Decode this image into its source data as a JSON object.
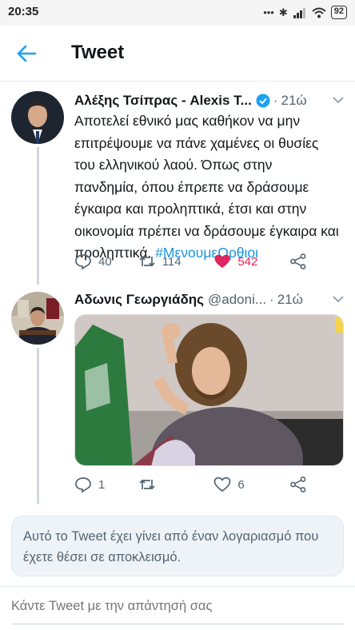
{
  "status": {
    "time": "20:35",
    "battery": "92"
  },
  "header": {
    "title": "Tweet"
  },
  "tweet1": {
    "name": "Αλέξης Τσίπρας - Alexis T...",
    "time": "21ώ",
    "text": "Αποτελεί εθνικό μας καθήκον να μην επιτρέψουμε να πάνε χαμένες οι θυσίες του ελληνικού λαού. Όπως στην πανδημία, όπου έπρεπε να δράσουμε έγκαιρα και προληπτικά, έτσι και στην οικονομία πρέπει να δράσουμε έγκαιρα και προληπτικά.",
    "hashtag": "#ΜενουμεΟρθιοι",
    "replies": "40",
    "retweets": "114",
    "likes": "542",
    "like_color": "#e0245e"
  },
  "tweet2": {
    "name": "Αδωνις Γεωργιάδης",
    "handle": "@adoni...",
    "time": "21ώ",
    "replies": "1",
    "retweets": "",
    "likes": "6"
  },
  "notice": {
    "text": "Αυτό το Tweet έχει γίνει από έναν λογαριασμό που έχετε θέσει σε αποκλεισμό."
  },
  "reply": {
    "placeholder": "Κάντε Tweet με την απάντησή σας"
  },
  "colors": {
    "accent": "#1da1f2",
    "icon_gray": "#536471"
  }
}
